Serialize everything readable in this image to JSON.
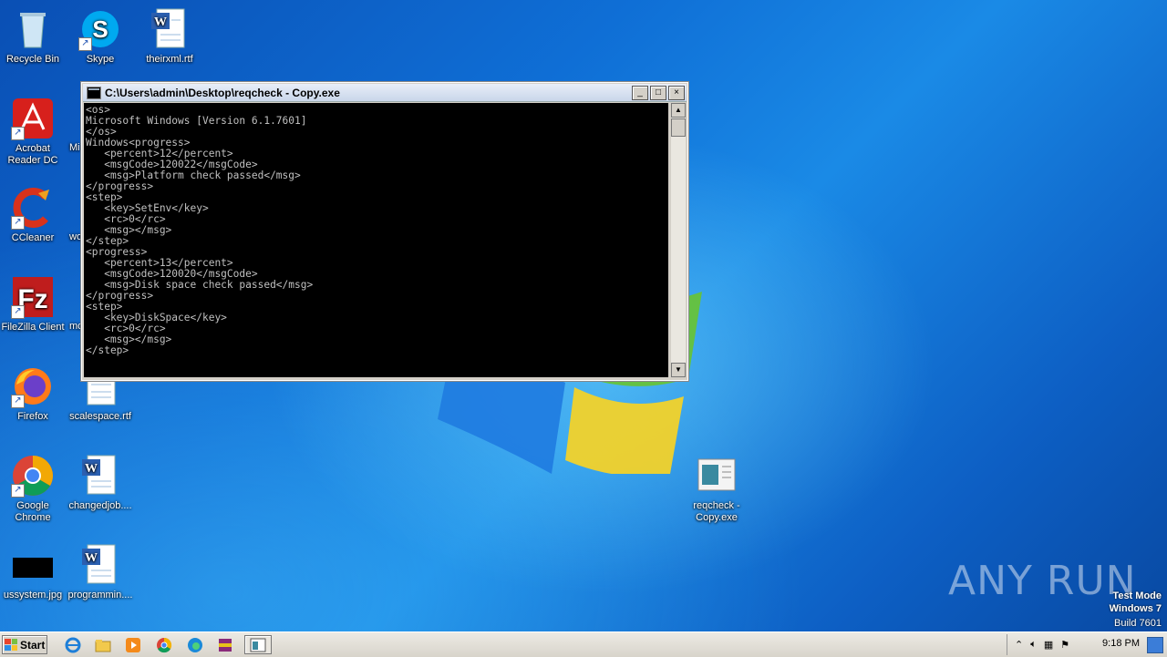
{
  "desktop": {
    "icons": [
      {
        "label": "Recycle Bin"
      },
      {
        "label": "Skype"
      },
      {
        "label": "theirxml.rtf"
      },
      {
        "label": "Acrobat Reader DC"
      },
      {
        "label": "Mi"
      },
      {
        "label": "CCleaner"
      },
      {
        "label": "wo"
      },
      {
        "label": "FileZilla Client"
      },
      {
        "label": "mo"
      },
      {
        "label": "Firefox"
      },
      {
        "label": "scalespace.rtf"
      },
      {
        "label": "Google Chrome"
      },
      {
        "label": "changedjob...."
      },
      {
        "label": "ussystem.jpg"
      },
      {
        "label": "programmin...."
      },
      {
        "label": "reqcheck - Copy.exe"
      }
    ]
  },
  "console": {
    "title": "C:\\Users\\admin\\Desktop\\reqcheck - Copy.exe",
    "output": "<os>\nMicrosoft Windows [Version 6.1.7601]\n</os>\nWindows<progress>\n   <percent>12</percent>\n   <msgCode>120022</msgCode>\n   <msg>Platform check passed</msg>\n</progress>\n<step>\n   <key>SetEnv</key>\n   <rc>0</rc>\n   <msg></msg>\n</step>\n<progress>\n   <percent>13</percent>\n   <msgCode>120020</msgCode>\n   <msg>Disk space check passed</msg>\n</progress>\n<step>\n   <key>DiskSpace</key>\n   <rc>0</rc>\n   <msg></msg>\n</step>",
    "buttons": {
      "minimize": "_",
      "maximize": "□",
      "close": "×"
    }
  },
  "taskbar": {
    "start_label": "Start",
    "clock": "9:18 PM"
  },
  "watermark": {
    "line1": "Test Mode",
    "line2": "Windows 7",
    "line3": "Build 7601",
    "brand": "ANY RUN"
  },
  "colors": {
    "console_bg": "#000000",
    "console_text": "#c0c0c0",
    "desktop_blue": "#0f6fd6"
  }
}
